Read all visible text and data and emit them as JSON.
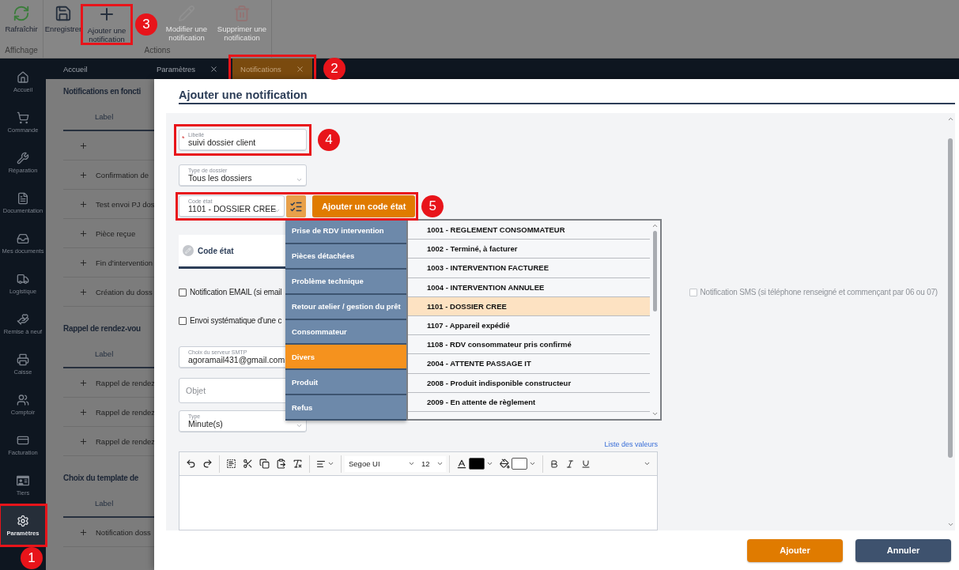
{
  "ribbon": {
    "groups": [
      {
        "label": "Affichage",
        "buttons": [
          {
            "label": "Rafraîchir",
            "disabled": false
          }
        ]
      },
      {
        "label": "Actions",
        "buttons": [
          {
            "label": "Enregistrer",
            "disabled": false
          },
          {
            "label": "Ajouter une notification",
            "disabled": false,
            "callout": "3"
          },
          {
            "label": "Modifier une notification",
            "disabled": true
          },
          {
            "label": "Supprimer une notification",
            "disabled": true
          }
        ]
      }
    ]
  },
  "tabs": [
    {
      "label": "Accueil",
      "closable": false,
      "selected": false
    },
    {
      "label": "Paramètres",
      "closable": true,
      "selected": false
    },
    {
      "label": "Notifications",
      "closable": true,
      "selected": true,
      "callout": "2"
    }
  ],
  "sidebar": {
    "items": [
      {
        "label": "Accueil",
        "selected": false
      },
      {
        "label": "Commande",
        "selected": false
      },
      {
        "label": "Réparation",
        "selected": false
      },
      {
        "label": "Documentation",
        "selected": false
      },
      {
        "label": "Mes documents",
        "selected": false
      },
      {
        "label": "Logistique",
        "selected": false
      },
      {
        "label": "Remise à neuf",
        "selected": false
      },
      {
        "label": "Caisse",
        "selected": false
      },
      {
        "label": "Comptoir",
        "selected": false
      },
      {
        "label": "Facturation",
        "selected": false
      },
      {
        "label": "Tiers",
        "selected": false
      },
      {
        "label": "Paramètres",
        "selected": true,
        "callout": "1"
      }
    ]
  },
  "sections": [
    {
      "title": "Notifications en foncti",
      "column": "Label",
      "rows": [
        {
          "expanded": false
        },
        {
          "label": "Confirmation de",
          "expanded": false
        },
        {
          "label": "Test envoi PJ dos",
          "expanded": false
        },
        {
          "label": "Pièce reçue",
          "expanded": false
        },
        {
          "label": "Fin d'intervention",
          "expanded": false
        },
        {
          "label": "Création du doss",
          "expanded": false
        }
      ]
    },
    {
      "title": "Rappel de rendez-vou",
      "column": "Label",
      "rows": [
        {
          "label": "Rappel de rendez",
          "expanded": false
        },
        {
          "label": "Rappel de rendez",
          "expanded": false
        },
        {
          "label": "Rappel de rendez",
          "expanded": false
        }
      ]
    },
    {
      "title": "Choix du template de",
      "column": "Label",
      "rows": [
        {
          "label": "Notification doss",
          "expanded": false
        }
      ]
    }
  ],
  "dialog": {
    "title": "Ajouter une notification",
    "label_field": {
      "label": "Libellé",
      "value": "suivi dossier client",
      "required_mark": "*",
      "callout": "4"
    },
    "file_type": {
      "label": "Type de dossier",
      "value": "Tous les dossiers"
    },
    "status_code": {
      "label": "Code état",
      "value": "1101 - DOSSIER CREE",
      "callout": "5"
    },
    "add_status_button": "Ajouter un code état",
    "tabs": [
      {
        "label": "Code état",
        "selected": true
      }
    ],
    "checkbox_rows": [
      {
        "items": [
          {
            "label": "Notification EMAIL (si email",
            "checked": false,
            "disabled": false
          },
          {
            "label": "Notification SMS (si téléphone renseigné et commençant par 06 ou 07)",
            "checked": false,
            "disabled": true
          }
        ]
      },
      {
        "items": [
          {
            "label": "Envoi systématique d'une c",
            "checked": false,
            "disabled": false
          }
        ]
      }
    ],
    "smtp": {
      "label": "Choix du serveur SMTP",
      "value": "agoramail431@gmail.com"
    },
    "subject": {
      "placeholder": "Objet"
    },
    "type": {
      "label": "Type",
      "value": "Minute(s)"
    },
    "values_link": "Liste des valeurs",
    "editor": {
      "font": "Segoe UI",
      "size": "12"
    },
    "popup": {
      "categories": [
        {
          "label": "Prise de RDV intervention",
          "selected": false
        },
        {
          "label": "Pièces détachées",
          "selected": false
        },
        {
          "label": "Problème technique",
          "selected": false
        },
        {
          "label": "Retour atelier / gestion du prêt",
          "selected": false
        },
        {
          "label": "Consommateur",
          "selected": false
        },
        {
          "label": "Divers",
          "selected": true
        },
        {
          "label": "Produit",
          "selected": false
        },
        {
          "label": "Refus",
          "selected": false
        }
      ],
      "codes": [
        {
          "label": "1001 - REGLEMENT CONSOMMATEUR",
          "selected": false
        },
        {
          "label": "1002 - Terminé, à facturer",
          "selected": false
        },
        {
          "label": "1003 - INTERVENTION FACTUREE",
          "selected": false
        },
        {
          "label": "1004 - INTERVENTION ANNULEE",
          "selected": false
        },
        {
          "label": "1101 - DOSSIER CREE",
          "selected": true
        },
        {
          "label": "1107 - Appareil expédié",
          "selected": false
        },
        {
          "label": "1108 - RDV consommateur pris confirmé",
          "selected": false
        },
        {
          "label": "2004 - ATTENTE PASSAGE IT",
          "selected": false
        },
        {
          "label": "2008 - Produit indisponible constructeur",
          "selected": false
        },
        {
          "label": "2009 - En attente de règlement",
          "selected": false
        }
      ]
    },
    "buttons": [
      {
        "label": "Ajouter",
        "kind": "primary"
      },
      {
        "label": "Annuler",
        "kind": "secondary"
      }
    ]
  }
}
